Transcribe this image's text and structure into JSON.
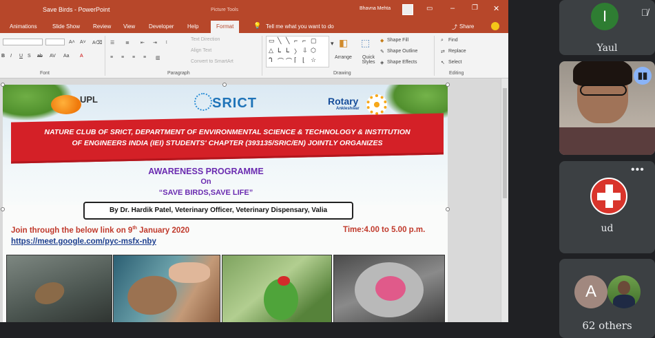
{
  "ppt": {
    "title": "Save Birds - PowerPoint",
    "context_tab": "Picture Tools",
    "user": "Bhavna Mehta",
    "tabs": [
      "Animations",
      "Slide Show",
      "Review",
      "View",
      "Developer",
      "Help",
      "Format"
    ],
    "tell_me": "Tell me what you want to do",
    "share": "Share",
    "ribbon": {
      "text_direction": "Text Direction",
      "align_text": "Align Text",
      "convert_smartart": "Convert to SmartArt",
      "arrange": "Arrange",
      "quick_styles": "Quick Styles",
      "shape_fill": "Shape Fill",
      "shape_outline": "Shape Outline",
      "shape_effects": "Shape Effects",
      "find": "Find",
      "replace": "Replace",
      "select": "Select",
      "groups": {
        "font": "Font",
        "paragraph": "Paragraph",
        "drawing": "Drawing",
        "editing": "Editing"
      }
    }
  },
  "slide": {
    "logo_upl": "UPL",
    "logo_srict": "SRICT",
    "logo_rotary": "Rotary",
    "logo_rotary_sub": "Ankleshwar",
    "banner_line1": "NATURE CLUB OF SRICT, DEPARTMENT OF ENVIRONMENTAL SCIENCE & TECHNOLOGY & INSTITUTION",
    "banner_line2": "OF ENGINEERS INDIA (IEI) STUDENTS' CHAPTER (393135/SRIC/EN) JOINTLY ORGANIZES",
    "programme_1": "AWARENESS PROGRAMME",
    "programme_2": "On",
    "programme_3": "“SAVE BIRDS,SAVE LIFE”",
    "speaker": "By Dr. Hardik Patel, Veterinary Officer, Veterinary Dispensary, Valia",
    "join_pre": "Join through the below link on 9",
    "join_sup": "th",
    "join_post": " January 2020",
    "time": "Time:4.00 to 5.00 p.m.",
    "link": "https://meet.google.com/pyc-msfx-nby"
  },
  "meet": {
    "tile1_initial": "I",
    "tile1_name": "Yaul",
    "tile3_name": "ud",
    "others_initial": "A",
    "others": "62 others"
  },
  "colors": {
    "ppt_red": "#b7472a",
    "banner_red": "#d42027",
    "programme_purple": "#6a2bb0",
    "link_blue": "#1d3f8f",
    "meet_bg": "#202124"
  }
}
